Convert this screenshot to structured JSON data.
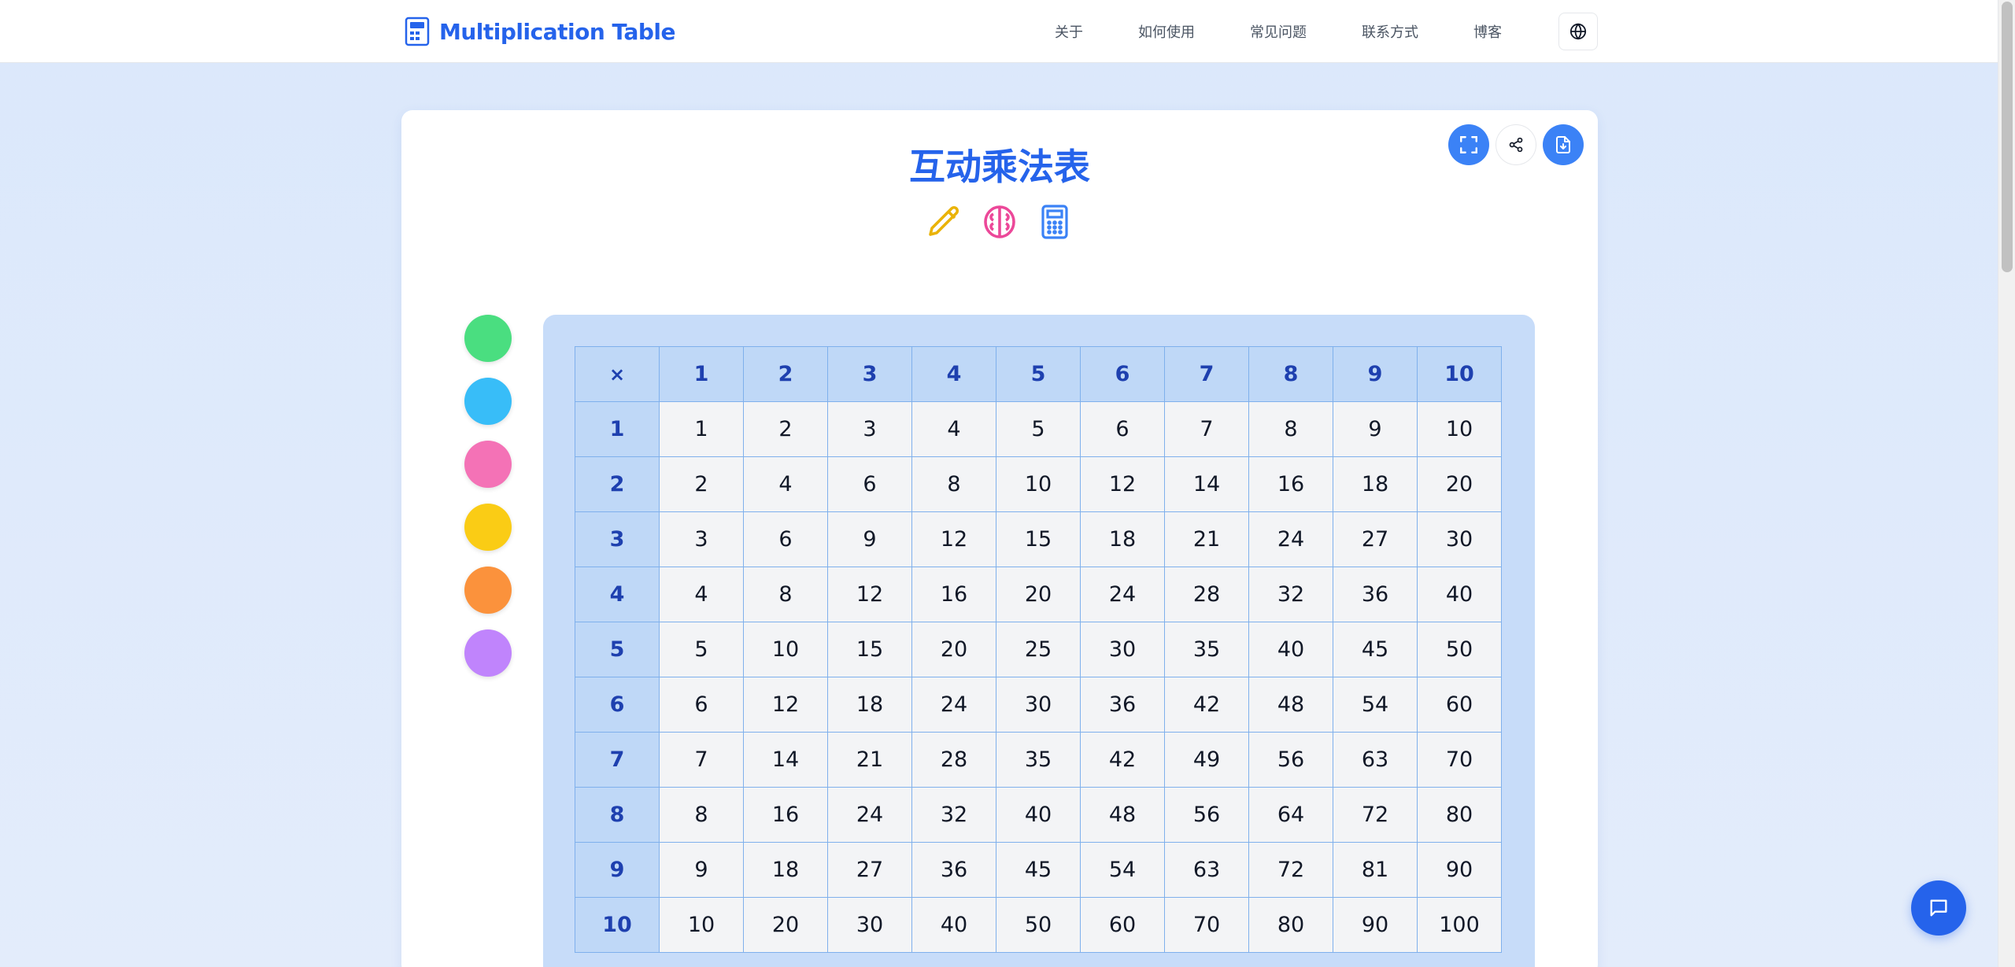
{
  "header": {
    "brand": "Multiplication Table",
    "nav": [
      "关于",
      "如何使用",
      "常见问题",
      "联系方式",
      "博客"
    ],
    "language_icon": "globe-icon",
    "brand_icon": "calculator-icon"
  },
  "main": {
    "title": "互动乘法表",
    "title_icons": [
      "pencil-icon",
      "brain-icon",
      "calculator-icon"
    ],
    "tools": {
      "fullscreen_icon": "fullscreen-icon",
      "share_icon": "share-icon",
      "download_icon": "download-file-icon"
    },
    "color_options": [
      "#4ade80",
      "#38bdf8",
      "#f472b6",
      "#facc15",
      "#fb923c",
      "#c084fc"
    ]
  },
  "table": {
    "corner": "×",
    "columns": [
      "1",
      "2",
      "3",
      "4",
      "5",
      "6",
      "7",
      "8",
      "9",
      "10"
    ],
    "rows": [
      {
        "label": "1",
        "cells": [
          "1",
          "2",
          "3",
          "4",
          "5",
          "6",
          "7",
          "8",
          "9",
          "10"
        ]
      },
      {
        "label": "2",
        "cells": [
          "2",
          "4",
          "6",
          "8",
          "10",
          "12",
          "14",
          "16",
          "18",
          "20"
        ]
      },
      {
        "label": "3",
        "cells": [
          "3",
          "6",
          "9",
          "12",
          "15",
          "18",
          "21",
          "24",
          "27",
          "30"
        ]
      },
      {
        "label": "4",
        "cells": [
          "4",
          "8",
          "12",
          "16",
          "20",
          "24",
          "28",
          "32",
          "36",
          "40"
        ]
      },
      {
        "label": "5",
        "cells": [
          "5",
          "10",
          "15",
          "20",
          "25",
          "30",
          "35",
          "40",
          "45",
          "50"
        ]
      },
      {
        "label": "6",
        "cells": [
          "6",
          "12",
          "18",
          "24",
          "30",
          "36",
          "42",
          "48",
          "54",
          "60"
        ]
      },
      {
        "label": "7",
        "cells": [
          "7",
          "14",
          "21",
          "28",
          "35",
          "42",
          "49",
          "56",
          "63",
          "70"
        ]
      },
      {
        "label": "8",
        "cells": [
          "8",
          "16",
          "24",
          "32",
          "40",
          "48",
          "56",
          "64",
          "72",
          "80"
        ]
      },
      {
        "label": "9",
        "cells": [
          "9",
          "18",
          "27",
          "36",
          "45",
          "54",
          "63",
          "72",
          "81",
          "90"
        ]
      },
      {
        "label": "10",
        "cells": [
          "10",
          "20",
          "30",
          "40",
          "50",
          "60",
          "70",
          "80",
          "90",
          "100"
        ]
      }
    ]
  },
  "chat": {
    "icon": "chat-icon"
  },
  "colors": {
    "accent": "#2563eb",
    "button": "#3b82f6",
    "table_frame": "#c7dcf9"
  }
}
